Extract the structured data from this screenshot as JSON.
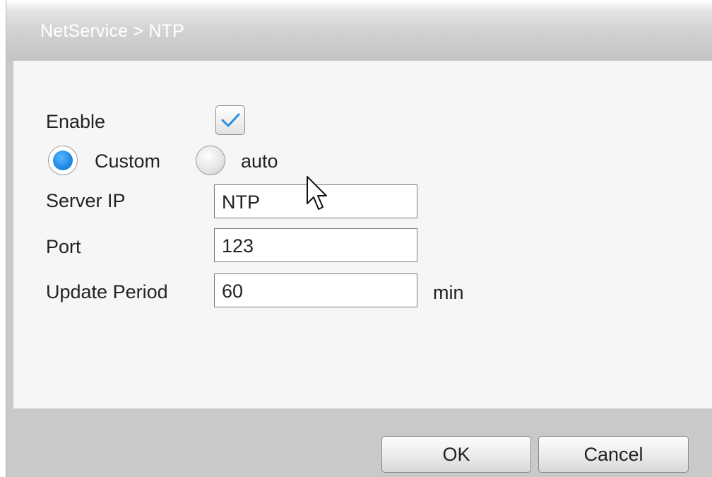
{
  "window": {
    "title": "NetService > NTP"
  },
  "form": {
    "enable_label": "Enable",
    "enable_checked": true,
    "mode": {
      "custom_label": "Custom",
      "auto_label": "auto",
      "selected": "Custom"
    },
    "server_ip": {
      "label": "Server IP",
      "value": "NTP"
    },
    "port": {
      "label": "Port",
      "value": "123"
    },
    "update_period": {
      "label": "Update Period",
      "value": "60",
      "unit": "min"
    }
  },
  "buttons": {
    "ok": "OK",
    "cancel": "Cancel"
  },
  "colors": {
    "accent": "#1e88e8",
    "check": "#2a8ee6",
    "panel_bg": "#f6f6f6",
    "frame_bg": "#c9c9c9"
  },
  "icons": {
    "checkmark": "check-icon",
    "pointer": "mouse-cursor-icon"
  }
}
